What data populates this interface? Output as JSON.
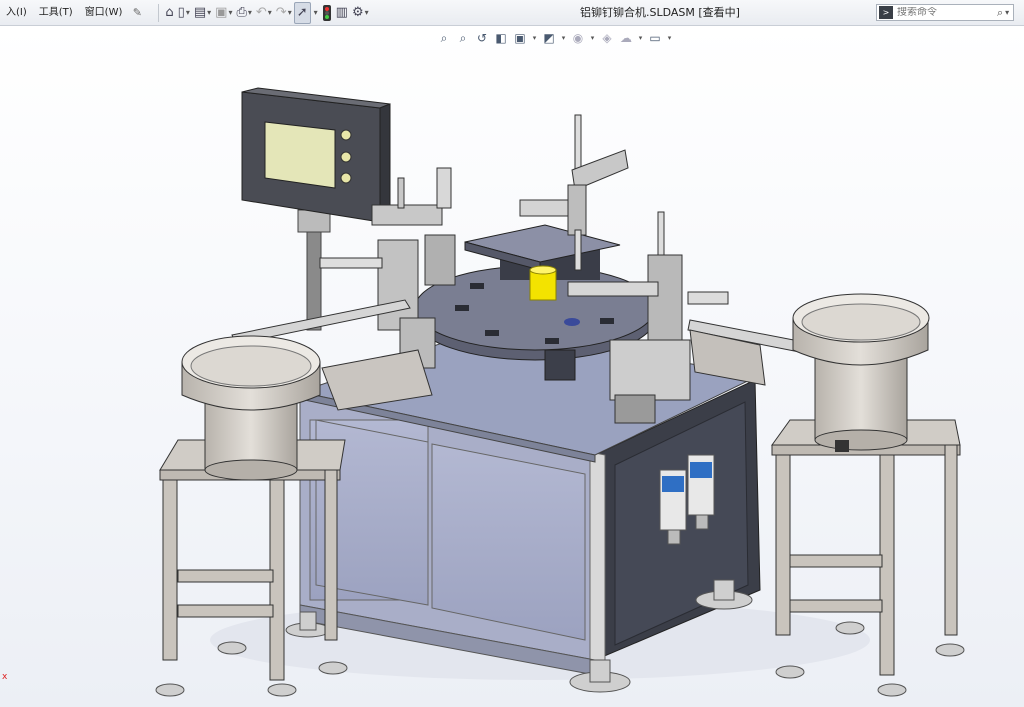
{
  "menu": {
    "items": [
      {
        "label": "入)",
        "sub": ""
      },
      {
        "label": "工具(T)"
      },
      {
        "label": "窗口(W)"
      }
    ]
  },
  "window": {
    "title": "铝铆钉铆合机.SLDASM [查看中]"
  },
  "search": {
    "placeholder": "搜索命令"
  },
  "icons": {
    "toolbar": [
      "home-icon",
      "new-document-icon",
      "open-icon",
      "save-icon",
      "print-icon",
      "undo-icon",
      "redo-icon",
      "select-arrow-icon",
      "traffic-light-icon",
      "file-properties-icon",
      "options-gear-icon"
    ],
    "view": [
      "zoom-to-fit-icon",
      "zoom-area-icon",
      "previous-view-icon",
      "section-view-icon",
      "view-orientation-icon",
      "display-style-icon",
      "hide-show-icon",
      "appearance-icon",
      "scene-icon",
      "display-settings-icon"
    ]
  },
  "colors": {
    "frame": "#9aa2b8",
    "panel": "#a9aec8",
    "dark_panel": "#3b3e48",
    "steel": "#c9c9c9",
    "bowl": "#cfcac3",
    "accent_yellow": "#f3e300"
  }
}
